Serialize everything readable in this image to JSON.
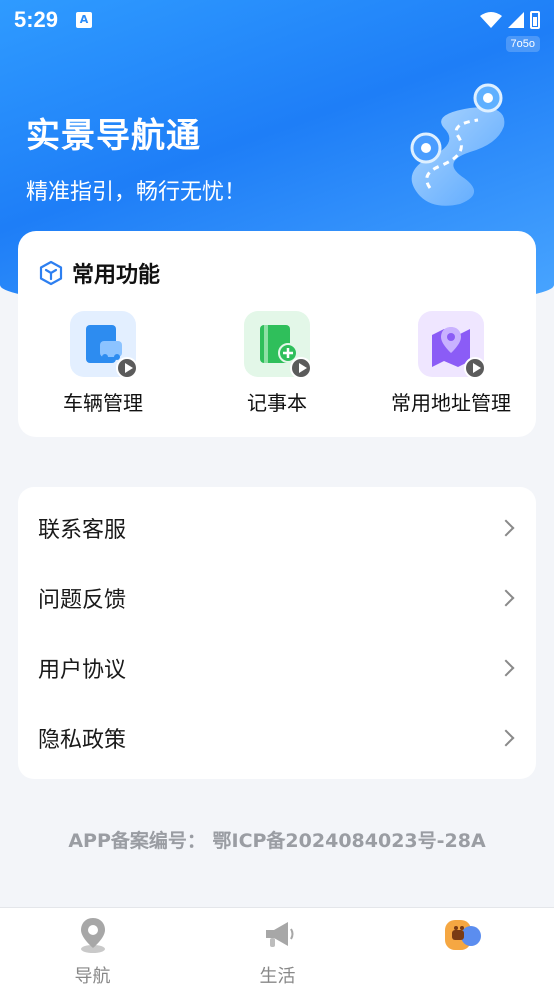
{
  "status_bar": {
    "time": "5:29",
    "notification_icon": "A",
    "badge": "7o5o"
  },
  "hero": {
    "title": "实景导航通",
    "subtitle": "精准指引，畅行无忧！"
  },
  "functions": {
    "title": "常用功能",
    "items": [
      {
        "label": "车辆管理",
        "icon": "car-door-icon",
        "color": "#2d8cf0"
      },
      {
        "label": "记事本",
        "icon": "notebook-add-icon",
        "color": "#2fbf5b"
      },
      {
        "label": "常用地址管理",
        "icon": "map-pin-icon",
        "color": "#8b5cf6"
      }
    ]
  },
  "menu": {
    "items": [
      {
        "label": "联系客服"
      },
      {
        "label": "问题反馈"
      },
      {
        "label": "用户协议"
      },
      {
        "label": "隐私政策"
      }
    ]
  },
  "icp": "APP备案编号： 鄂ICP备2024084023号-28A",
  "tabs": [
    {
      "label": "导航",
      "icon": "location-pin-icon"
    },
    {
      "label": "生活",
      "icon": "megaphone-icon"
    },
    {
      "label": "",
      "icon": "profile-avatar-icon"
    }
  ]
}
